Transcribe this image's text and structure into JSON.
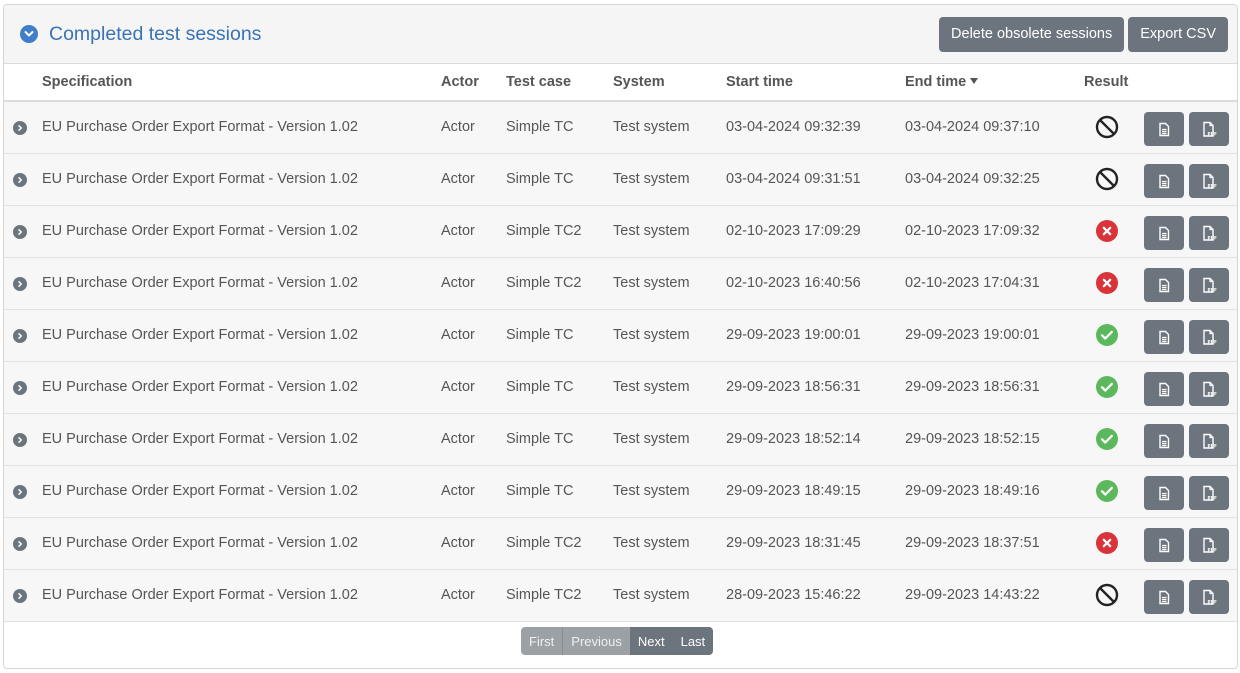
{
  "panel": {
    "title": "Completed test sessions",
    "buttons": {
      "delete_obsolete": "Delete obsolete sessions",
      "export_csv": "Export CSV"
    }
  },
  "table": {
    "columns": {
      "specification": "Specification",
      "actor": "Actor",
      "test_case": "Test case",
      "system": "System",
      "start_time": "Start time",
      "end_time": "End time",
      "result": "Result"
    },
    "sort": {
      "column": "End time",
      "direction": "descending"
    },
    "rows": [
      {
        "specification": "EU Purchase Order Export Format - Version 1.02",
        "actor": "Actor",
        "test_case": "Simple TC",
        "system": "Test system",
        "start_time": "03-04-2024 09:32:39",
        "end_time": "03-04-2024 09:37:10",
        "result": "undefined"
      },
      {
        "specification": "EU Purchase Order Export Format - Version 1.02",
        "actor": "Actor",
        "test_case": "Simple TC",
        "system": "Test system",
        "start_time": "03-04-2024 09:31:51",
        "end_time": "03-04-2024 09:32:25",
        "result": "undefined"
      },
      {
        "specification": "EU Purchase Order Export Format - Version 1.02",
        "actor": "Actor",
        "test_case": "Simple TC2",
        "system": "Test system",
        "start_time": "02-10-2023 17:09:29",
        "end_time": "02-10-2023 17:09:32",
        "result": "failure"
      },
      {
        "specification": "EU Purchase Order Export Format - Version 1.02",
        "actor": "Actor",
        "test_case": "Simple TC2",
        "system": "Test system",
        "start_time": "02-10-2023 16:40:56",
        "end_time": "02-10-2023 17:04:31",
        "result": "failure"
      },
      {
        "specification": "EU Purchase Order Export Format - Version 1.02",
        "actor": "Actor",
        "test_case": "Simple TC",
        "system": "Test system",
        "start_time": "29-09-2023 19:00:01",
        "end_time": "29-09-2023 19:00:01",
        "result": "success"
      },
      {
        "specification": "EU Purchase Order Export Format - Version 1.02",
        "actor": "Actor",
        "test_case": "Simple TC",
        "system": "Test system",
        "start_time": "29-09-2023 18:56:31",
        "end_time": "29-09-2023 18:56:31",
        "result": "success"
      },
      {
        "specification": "EU Purchase Order Export Format - Version 1.02",
        "actor": "Actor",
        "test_case": "Simple TC",
        "system": "Test system",
        "start_time": "29-09-2023 18:52:14",
        "end_time": "29-09-2023 18:52:15",
        "result": "success"
      },
      {
        "specification": "EU Purchase Order Export Format - Version 1.02",
        "actor": "Actor",
        "test_case": "Simple TC",
        "system": "Test system",
        "start_time": "29-09-2023 18:49:15",
        "end_time": "29-09-2023 18:49:16",
        "result": "success"
      },
      {
        "specification": "EU Purchase Order Export Format - Version 1.02",
        "actor": "Actor",
        "test_case": "Simple TC2",
        "system": "Test system",
        "start_time": "29-09-2023 18:31:45",
        "end_time": "29-09-2023 18:37:51",
        "result": "failure"
      },
      {
        "specification": "EU Purchase Order Export Format - Version 1.02",
        "actor": "Actor",
        "test_case": "Simple TC2",
        "system": "Test system",
        "start_time": "28-09-2023 15:46:22",
        "end_time": "29-09-2023 14:43:22",
        "result": "undefined"
      }
    ],
    "row_actions": {
      "view_icon": "document-icon",
      "pdf_icon": "pdf-report-icon"
    }
  },
  "pagination": {
    "first": "First",
    "previous": "Previous",
    "next": "Next",
    "last": "Last"
  },
  "colors": {
    "accent": "#3973b5",
    "button": "#6c757d",
    "success": "#5cb85c",
    "failure": "#d9343a",
    "undefined": "#222222"
  }
}
